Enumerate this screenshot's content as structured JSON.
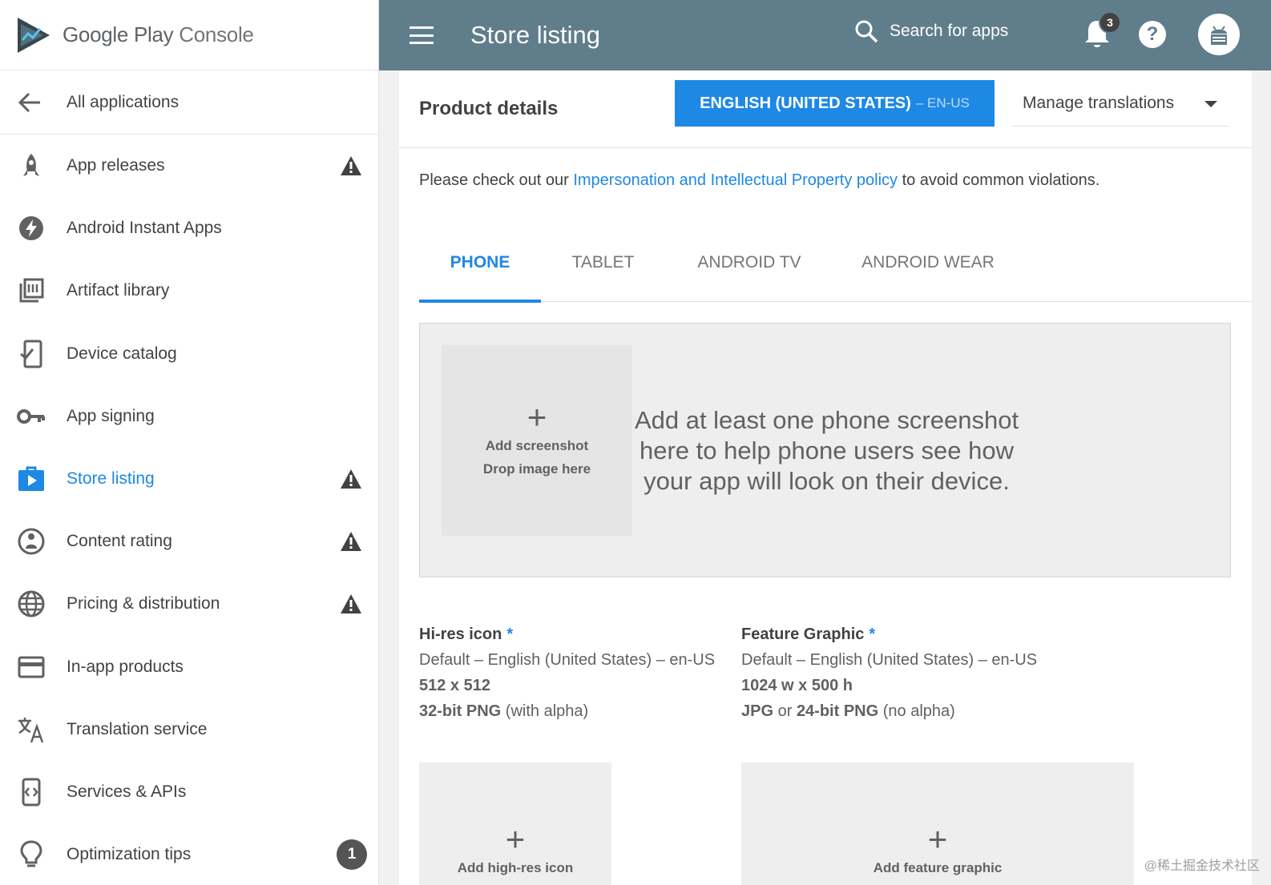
{
  "brand": {
    "google_play": "Google Play",
    "console": "Console"
  },
  "sidebar": {
    "back_label": "All applications",
    "items": [
      {
        "label": "App releases",
        "icon": "rocket-icon",
        "warning": true,
        "active": false
      },
      {
        "label": "Android Instant Apps",
        "icon": "bolt-icon",
        "warning": false,
        "active": false
      },
      {
        "label": "Artifact library",
        "icon": "library-icon",
        "warning": false,
        "active": false
      },
      {
        "label": "Device catalog",
        "icon": "device-check-icon",
        "warning": false,
        "active": false
      },
      {
        "label": "App signing",
        "icon": "key-icon",
        "warning": false,
        "active": false
      },
      {
        "label": "Store listing",
        "icon": "store-bag-icon",
        "warning": true,
        "active": true
      },
      {
        "label": "Content rating",
        "icon": "rating-icon",
        "warning": true,
        "active": false
      },
      {
        "label": "Pricing & distribution",
        "icon": "globe-icon",
        "warning": true,
        "active": false
      },
      {
        "label": "In-app products",
        "icon": "card-icon",
        "warning": false,
        "active": false
      },
      {
        "label": "Translation service",
        "icon": "translate-icon",
        "warning": false,
        "active": false
      },
      {
        "label": "Services & APIs",
        "icon": "api-icon",
        "warning": false,
        "active": false
      },
      {
        "label": "Optimization tips",
        "icon": "lightbulb-icon",
        "warning": false,
        "active": false,
        "badge": "1"
      }
    ]
  },
  "topbar": {
    "title": "Store listing",
    "search_placeholder": "Search for apps",
    "notification_count": "3",
    "help": "?"
  },
  "product": {
    "title": "Product details",
    "language_label": "ENGLISH (UNITED STATES)",
    "language_code": "– EN-US",
    "manage_translations": "Manage translations"
  },
  "policy": {
    "before": "Please check out our ",
    "link": "Impersonation and Intellectual Property policy",
    "after": " to avoid common violations."
  },
  "tabs": [
    "PHONE",
    "TABLET",
    "ANDROID TV",
    "ANDROID WEAR"
  ],
  "screenshots": {
    "plus": "+",
    "add_label": "Add screenshot",
    "drop_label": "Drop image here",
    "hint": "Add at least one phone screenshot here to help phone users see how your app will look on their device."
  },
  "hires_icon": {
    "title": "Hi-res icon",
    "required": "*",
    "default": "Default – English (United States) – en-US",
    "size": "512 x 512",
    "format_bold": "32-bit PNG",
    "format_rest": " (with alpha)",
    "upload_label": "Add high-res icon"
  },
  "feature_graphic": {
    "title": "Feature Graphic",
    "required": "*",
    "default": "Default – English (United States) – en-US",
    "size": "1024 w x 500 h",
    "format_a": "JPG",
    "format_or": " or ",
    "format_b": "24-bit PNG",
    "format_rest": " (no alpha)",
    "upload_label": "Add feature graphic"
  },
  "watermark": "@稀土掘金技术社区",
  "colors": {
    "accent": "#1e88e5",
    "topbar": "#607d8b",
    "warning": "#424242"
  }
}
